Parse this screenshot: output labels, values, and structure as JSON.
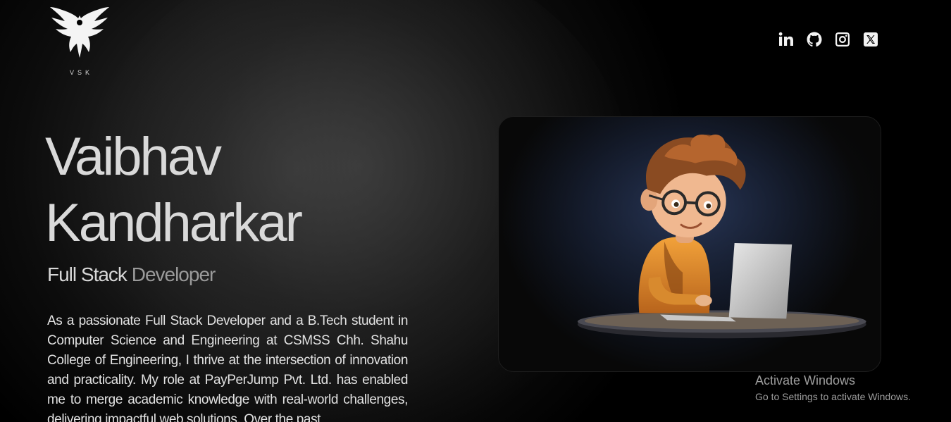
{
  "logo": {
    "text": "VSK",
    "icon": "eagle-logo-icon"
  },
  "socials": [
    {
      "label": "LinkedIn",
      "icon": "linkedin-icon"
    },
    {
      "label": "GitHub",
      "icon": "github-icon"
    },
    {
      "label": "Instagram",
      "icon": "instagram-icon"
    },
    {
      "label": "X",
      "icon": "x-icon"
    }
  ],
  "hero": {
    "first_name": "Vaibhav",
    "last_name": "Kandharkar",
    "role_primary": "Full Stack",
    "role_secondary": "Developer",
    "bio": "As a passionate Full Stack Developer and a B.Tech student in Computer Science and Engineering at CSMSS Chh. Shahu College of Engineering, I thrive at the intersection of innovation and practicality. My role at PayPerJump Pvt. Ltd. has enabled me to merge academic knowledge with real-world challenges, delivering impactful web solutions. Over the past"
  },
  "watermark": {
    "title": "Activate Windows",
    "subtitle": "Go to Settings to activate Windows."
  },
  "colors": {
    "background": "#000000",
    "text_primary": "#d9d9d9",
    "text_dim": "#9a9a9a"
  }
}
